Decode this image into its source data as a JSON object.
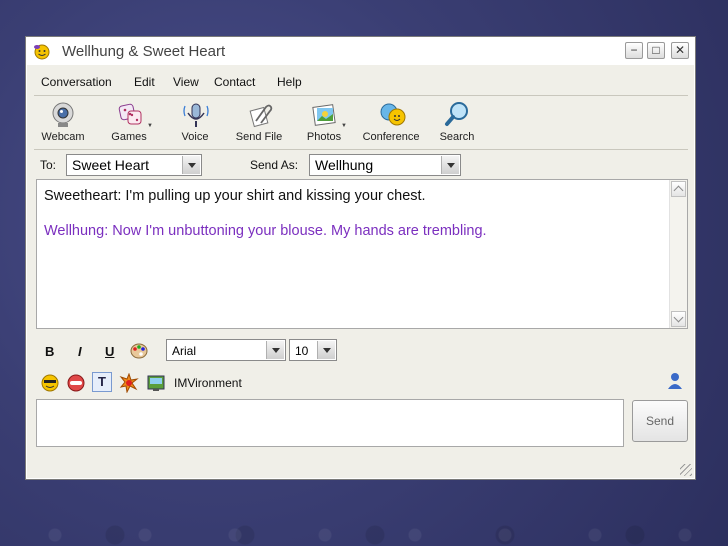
{
  "window": {
    "title": "Wellhung & Sweet Heart",
    "buttons": {
      "minimize": "−",
      "maximize": "□",
      "close": "✕"
    }
  },
  "menu": [
    "Conversation",
    "Edit",
    "View",
    "Contact",
    "Help"
  ],
  "toolbar": [
    {
      "label": "Webcam",
      "icon": "webcam-icon"
    },
    {
      "label": "Games",
      "icon": "dice-icon"
    },
    {
      "label": "Voice",
      "icon": "microphone-icon"
    },
    {
      "label": "Send File",
      "icon": "paperclip-icon"
    },
    {
      "label": "Photos",
      "icon": "photo-icon"
    },
    {
      "label": "Conference",
      "icon": "conference-icon"
    },
    {
      "label": "Search",
      "icon": "magnifier-icon"
    }
  ],
  "address": {
    "to_label": "To:",
    "to_value": "Sweet Heart",
    "send_as_label": "Send As:",
    "send_as_value": "Wellhung"
  },
  "history": [
    {
      "text": "Sweetheart: I'm pulling up your shirt and kissing your chest.",
      "color": "#111111"
    },
    {
      "text": "Wellhung: Now I'm unbuttoning your blouse. My hands are trembling.",
      "color": "#7b2fbf"
    }
  ],
  "format": {
    "bold": "B",
    "italic": "I",
    "underline": "U",
    "font_value": "Arial",
    "size_value": "10"
  },
  "imvironment_label": "IMVironment",
  "send_label": "Send"
}
